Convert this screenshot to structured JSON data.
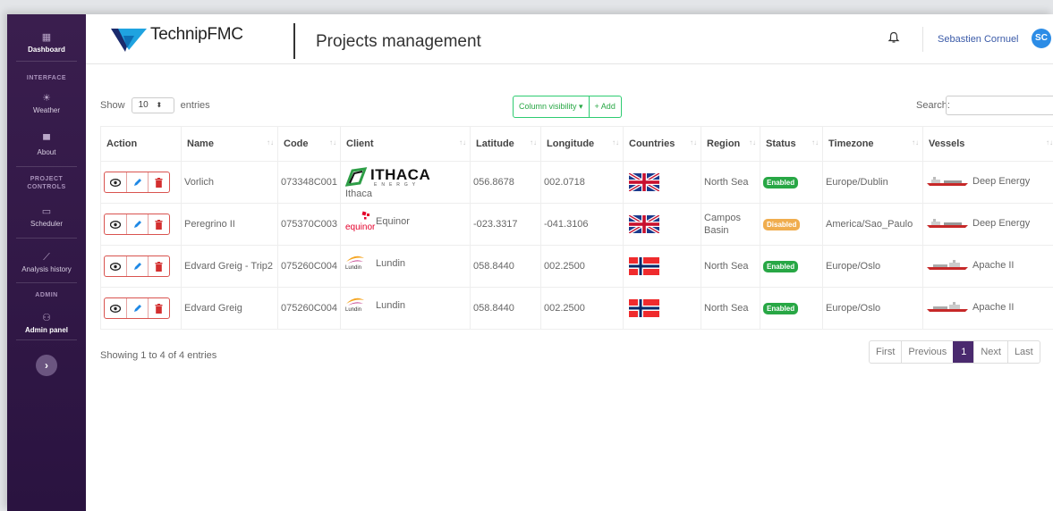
{
  "sidebar": {
    "dashboard_label": "Dashboard",
    "section_interface": "INTERFACE",
    "weather_label": "Weather",
    "about_label": "About",
    "section_project_controls": "PROJECT CONTROLS",
    "scheduler_label": "Scheduler",
    "analysis_label": "Analysis history",
    "section_admin": "ADMIN",
    "admin_panel_label": "Admin panel",
    "toggle_icon": "chevron-right-icon"
  },
  "header": {
    "brand": "TechnipFMC",
    "title": "Projects management",
    "user_name": "Sebastien Cornuel",
    "user_initials": "SC"
  },
  "controls": {
    "show_label": "Show",
    "entries_value": "10",
    "entries_label": "entries",
    "column_visibility": "Column visibility ▾",
    "add_label": "+ Add",
    "search_label": "Search:"
  },
  "table": {
    "columns": [
      "Action",
      "Name",
      "Code",
      "Client",
      "Latitude",
      "Longitude",
      "Countries",
      "Region",
      "Status",
      "Timezone",
      "Vessels"
    ],
    "rows": [
      {
        "name": "Vorlich",
        "code": "073348C001",
        "client": "Ithaca",
        "client_logo_text": "ITHACA",
        "client_logo_sub": "ENERGY",
        "latitude": "056.8678",
        "longitude": "002.0718",
        "country_flag": "uk-flag",
        "region": "North Sea",
        "status": "Enabled",
        "timezone": "Europe/Dublin",
        "vessel": "Deep Energy"
      },
      {
        "name": "Peregrino II",
        "code": "075370C003",
        "client": "Equinor",
        "client_logo_text": "equinor",
        "latitude": "-023.3317",
        "longitude": "-041.3106",
        "country_flag": "uk-flag",
        "region": "Campos Basin",
        "status": "Disabled",
        "timezone": "America/Sao_Paulo",
        "vessel": "Deep Energy"
      },
      {
        "name": "Edvard Greig - Trip2",
        "code": "075260C004",
        "client": "Lundin",
        "client_logo_text": "Lundin",
        "latitude": "058.8440",
        "longitude": "002.2500",
        "country_flag": "norway-flag",
        "region": "North Sea",
        "status": "Enabled",
        "timezone": "Europe/Oslo",
        "vessel": "Apache II"
      },
      {
        "name": "Edvard Greig",
        "code": "075260C004",
        "client": "Lundin",
        "client_logo_text": "Lundin",
        "latitude": "058.8440",
        "longitude": "002.2500",
        "country_flag": "norway-flag",
        "region": "North Sea",
        "status": "Enabled",
        "timezone": "Europe/Oslo",
        "vessel": "Apache II"
      }
    ]
  },
  "footer": {
    "info": "Showing 1 to 4 of 4 entries",
    "first": "First",
    "previous": "Previous",
    "page": "1",
    "next": "Next",
    "last": "Last"
  },
  "colors": {
    "sidebar": "#2e1744",
    "accent_green": "#28a745",
    "danger": "#d9534f",
    "warning": "#f0ad4e",
    "avatar": "#2c8ce6",
    "page_active": "#4a2a6e"
  }
}
